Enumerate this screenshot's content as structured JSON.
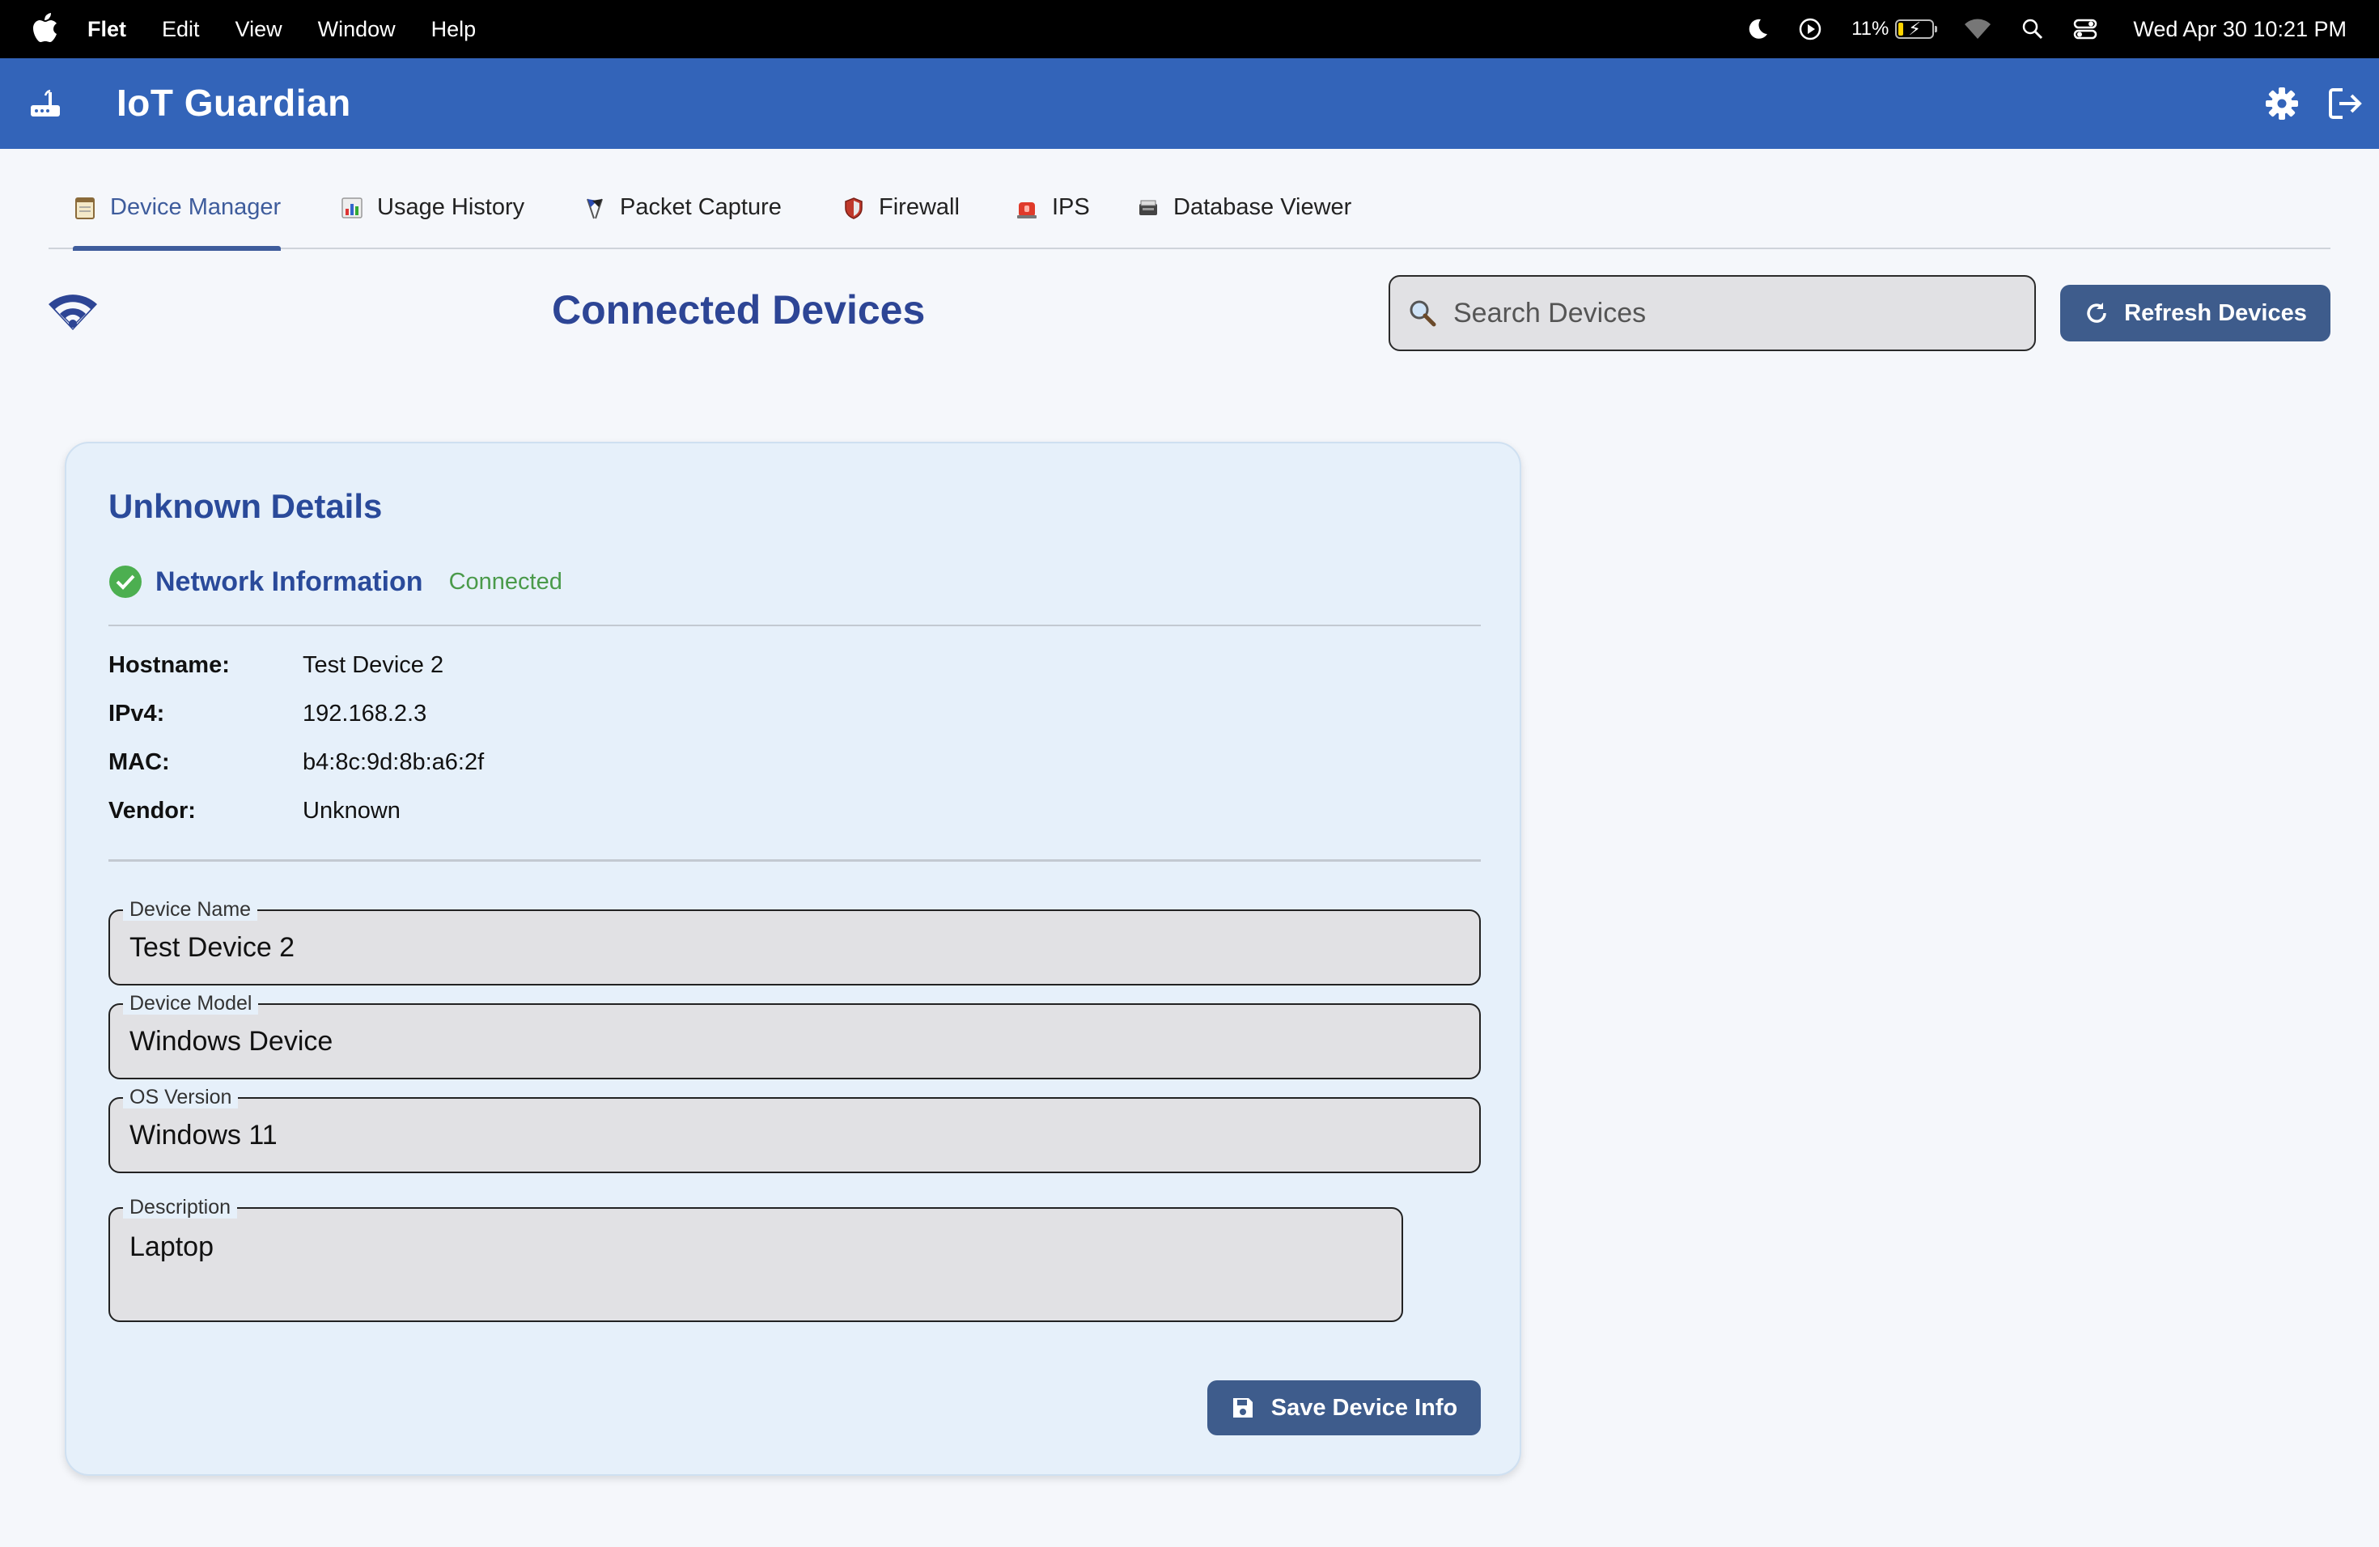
{
  "menubar": {
    "app_name": "Flet",
    "menus": [
      "Edit",
      "View",
      "Window",
      "Help"
    ],
    "battery": "11%",
    "clock": "Wed Apr 30  10:21 PM"
  },
  "header": {
    "title": "IoT Guardian"
  },
  "tabs": [
    {
      "label": "Device Manager",
      "icon": "notepad-icon",
      "active": true
    },
    {
      "label": "Usage History",
      "icon": "bar-chart-icon",
      "active": false
    },
    {
      "label": "Packet Capture",
      "icon": "flags-icon",
      "active": false
    },
    {
      "label": "Firewall",
      "icon": "shield-icon",
      "active": false
    },
    {
      "label": "IPS",
      "icon": "alarm-icon",
      "active": false
    },
    {
      "label": "Database Viewer",
      "icon": "card-box-icon",
      "active": false
    }
  ],
  "toolbar": {
    "page_title": "Connected Devices",
    "search_placeholder": "Search Devices",
    "refresh_label": "Refresh Devices"
  },
  "device": {
    "card_title": "Unknown Details",
    "section_title": "Network Information",
    "status": "Connected",
    "info": [
      {
        "key": "Hostname:",
        "value": "Test Device 2"
      },
      {
        "key": "IPv4:",
        "value": "192.168.2.3"
      },
      {
        "key": "MAC:",
        "value": "b4:8c:9d:8b:a6:2f"
      },
      {
        "key": "Vendor:",
        "value": "Unknown"
      }
    ],
    "fields": {
      "name_label": "Device Name",
      "name_value": "Test Device 2",
      "model_label": "Device Model",
      "model_value": "Windows Device",
      "os_label": "OS Version",
      "os_value": "Windows 11",
      "desc_label": "Description",
      "desc_value": "Laptop"
    },
    "save_label": "Save Device Info"
  },
  "colors": {
    "header_bg": "#3364b9",
    "accent": "#3e5c8c",
    "title_blue": "#2d4595",
    "connected_green": "#4a9a4a"
  }
}
